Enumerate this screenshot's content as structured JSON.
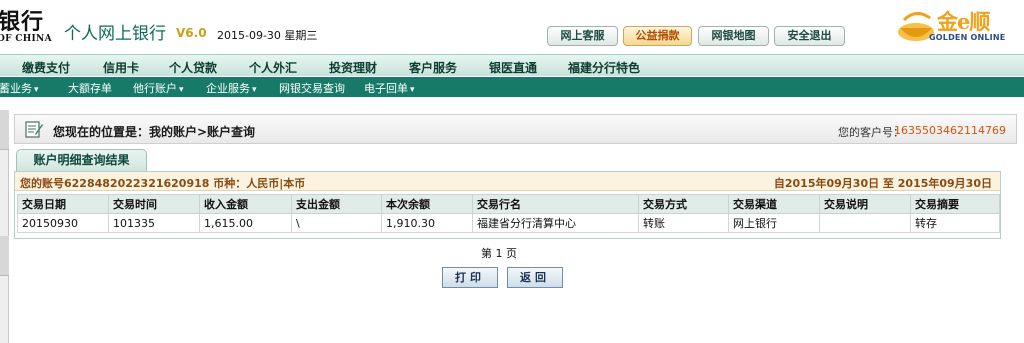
{
  "header": {
    "bank_name": "银行",
    "bank_en": "OF CHINA",
    "site_title": "个人网上银行",
    "version": "V6.0",
    "date": "2015-09-30 星期三",
    "buttons": {
      "service": "网上客服",
      "donate": "公益捐款",
      "map": "网银地图",
      "logout": "安全退出"
    },
    "golden": {
      "name": "金e顺",
      "en": "GOLDEN ONLINE",
      "accent": "#f0a21a"
    }
  },
  "main_nav": [
    "缴费支付",
    "信用卡",
    "个人贷款",
    "个人外汇",
    "投资理财",
    "客户服务",
    "银医直通",
    "福建分行特色"
  ],
  "sub_nav": [
    {
      "label": "储蓄业务",
      "dropdown": true
    },
    {
      "label": "大额存单",
      "dropdown": false
    },
    {
      "label": "他行账户",
      "dropdown": true
    },
    {
      "label": "企业服务",
      "dropdown": true
    },
    {
      "label": "网银交易查询",
      "dropdown": false
    },
    {
      "label": "电子回单",
      "dropdown": true
    }
  ],
  "breadcrumb": {
    "text": "您现在的位置是：我的账户>账户查询",
    "customer_label": "您的客户号：",
    "customer_no": "1635503462114769"
  },
  "tab_label": "账户明细查询结果",
  "account": {
    "summary": "您的账号6228482022321620918 币种：人民币|本币",
    "date_range": "自2015年09月30日  至  2015年09月30日"
  },
  "table": {
    "headers": [
      "交易日期",
      "交易时间",
      "收入金额",
      "支出金额",
      "本次余额",
      "交易行名",
      "交易方式",
      "交易渠道",
      "交易说明",
      "交易摘要"
    ],
    "rows": [
      [
        "20150930",
        "101335",
        "1,615.00",
        "\\",
        "1,910.30",
        "福建省分行清算中心",
        "转账",
        "网上银行",
        "",
        "转存"
      ]
    ]
  },
  "pagination": "第 1 页",
  "actions": {
    "print": "打印",
    "back": "返回"
  },
  "colors": {
    "nav_bg": "#177a68",
    "title_green": "#0f6a5a",
    "customer_no": "#d2530a"
  }
}
